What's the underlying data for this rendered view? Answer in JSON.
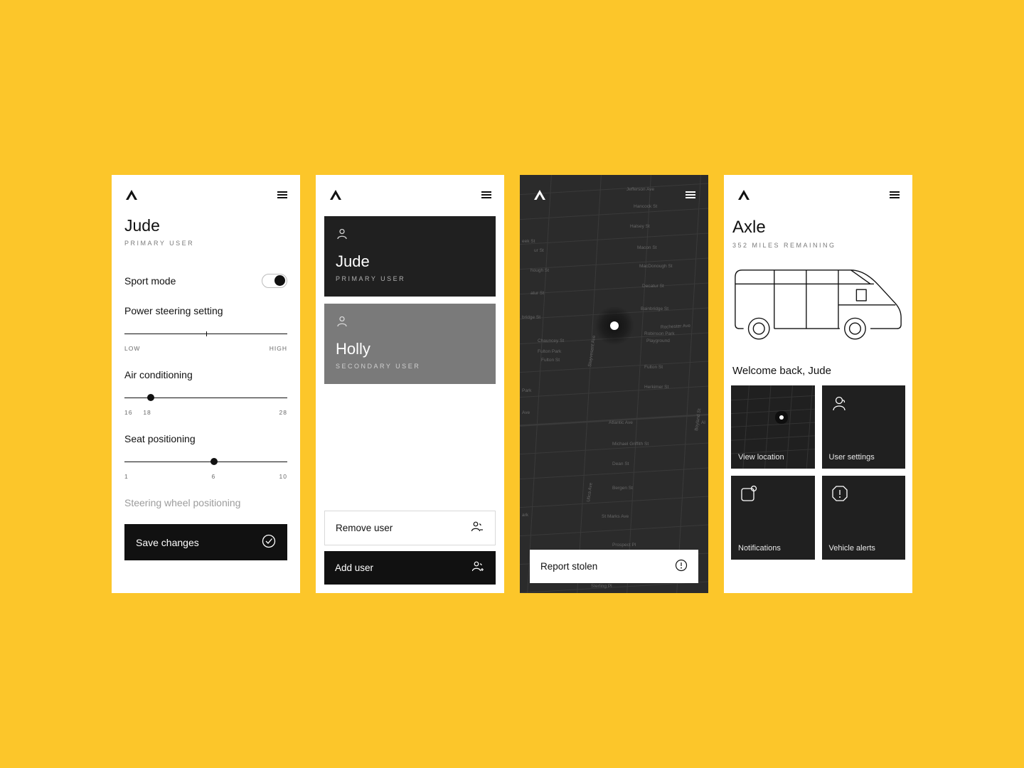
{
  "screen1": {
    "user_name": "Jude",
    "user_role": "PRIMARY USER",
    "sport_mode_label": "Sport mode",
    "sport_mode_on": true,
    "power_steering_label": "Power steering setting",
    "power_low": "LOW",
    "power_high": "HIGH",
    "ac_label": "Air conditioning",
    "ac_min": "16",
    "ac_val": "18",
    "ac_max": "28",
    "seat_label": "Seat positioning",
    "seat_min": "1",
    "seat_val": "6",
    "seat_max": "10",
    "steering_label": "Steering wheel positioning",
    "save_label": "Save changes"
  },
  "screen2": {
    "users": [
      {
        "name": "Jude",
        "role": "PRIMARY USER"
      },
      {
        "name": "Holly",
        "role": "SECONDARY USER"
      }
    ],
    "remove_label": "Remove user",
    "add_label": "Add user"
  },
  "screen3": {
    "report_label": "Report stolen",
    "streets": [
      "Jefferson Ave",
      "Hancock St",
      "Halsey St",
      "Macon St",
      "MacDonough St",
      "Decatur St",
      "Bainbridge St",
      "Chauncey St",
      "Fulton Park",
      "Fulton St",
      "Fulton St",
      "Herkimer St",
      "Atlantic Ave",
      "Michael Griffith St",
      "Dean St",
      "Bergen St",
      "St Marks Ave",
      "Prospect Pl",
      "Sterling Pl",
      "Utica Ave",
      "Stuyvesant Ave",
      "Rochester Ave",
      "Robinson Park Playground",
      "Park",
      "ark",
      "Ave",
      "bridge St",
      "atur St",
      "ur St",
      "hough St",
      "eek St",
      "Boyland St",
      "Al"
    ]
  },
  "screen4": {
    "vehicle_name": "Axle",
    "range_label": "352 MILES REMAINING",
    "welcome": "Welcome back, Jude",
    "cards": {
      "view_location": "View location",
      "user_settings": "User settings",
      "notifications": "Notifications",
      "vehicle_alerts": "Vehicle alerts"
    }
  }
}
